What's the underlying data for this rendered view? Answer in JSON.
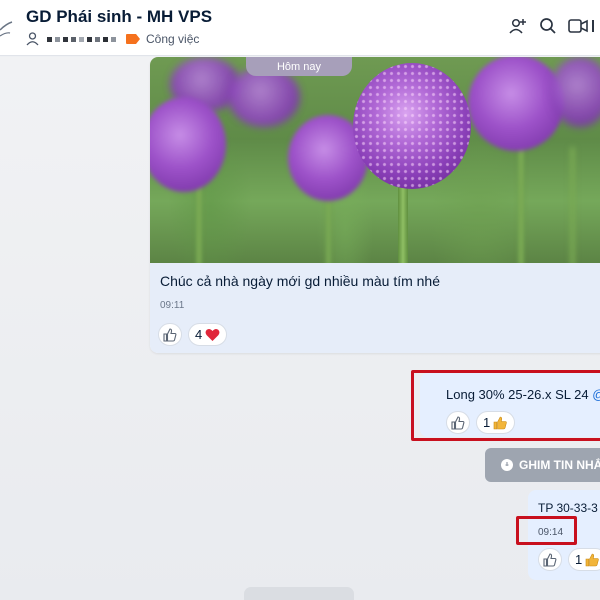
{
  "header": {
    "title": "GD Phái sinh - MH VPS",
    "tag_label": "Công việc",
    "icons": [
      "add-member-icon",
      "search-icon",
      "video-call-icon",
      "more-icon"
    ]
  },
  "colors": {
    "accent": "#1a6dd8",
    "sent_bubble": "#e5efff",
    "received_footer": "#e6edf9",
    "highlight": "#c8101e",
    "tag": "#f5711d"
  },
  "received_message": {
    "day_badge": "Hôm nay",
    "text": "Chúc cả nhà ngày mới gd nhiều màu tím nhé",
    "time": "09:11",
    "reaction_count": "4",
    "reaction_icon": "heart-icon"
  },
  "sent_message_1": {
    "text": "Long 30% 25-26.x SL 24 ",
    "mention": "@...",
    "reaction_count": "1",
    "reaction_icon": "thumbs-up-icon"
  },
  "pin_button": {
    "label": "GHIM TIN NHẮ"
  },
  "sent_message_2": {
    "text": "TP 30-33-3",
    "time": "09:14",
    "reaction_count": "1",
    "reaction_icon": "thumbs-up-icon"
  }
}
